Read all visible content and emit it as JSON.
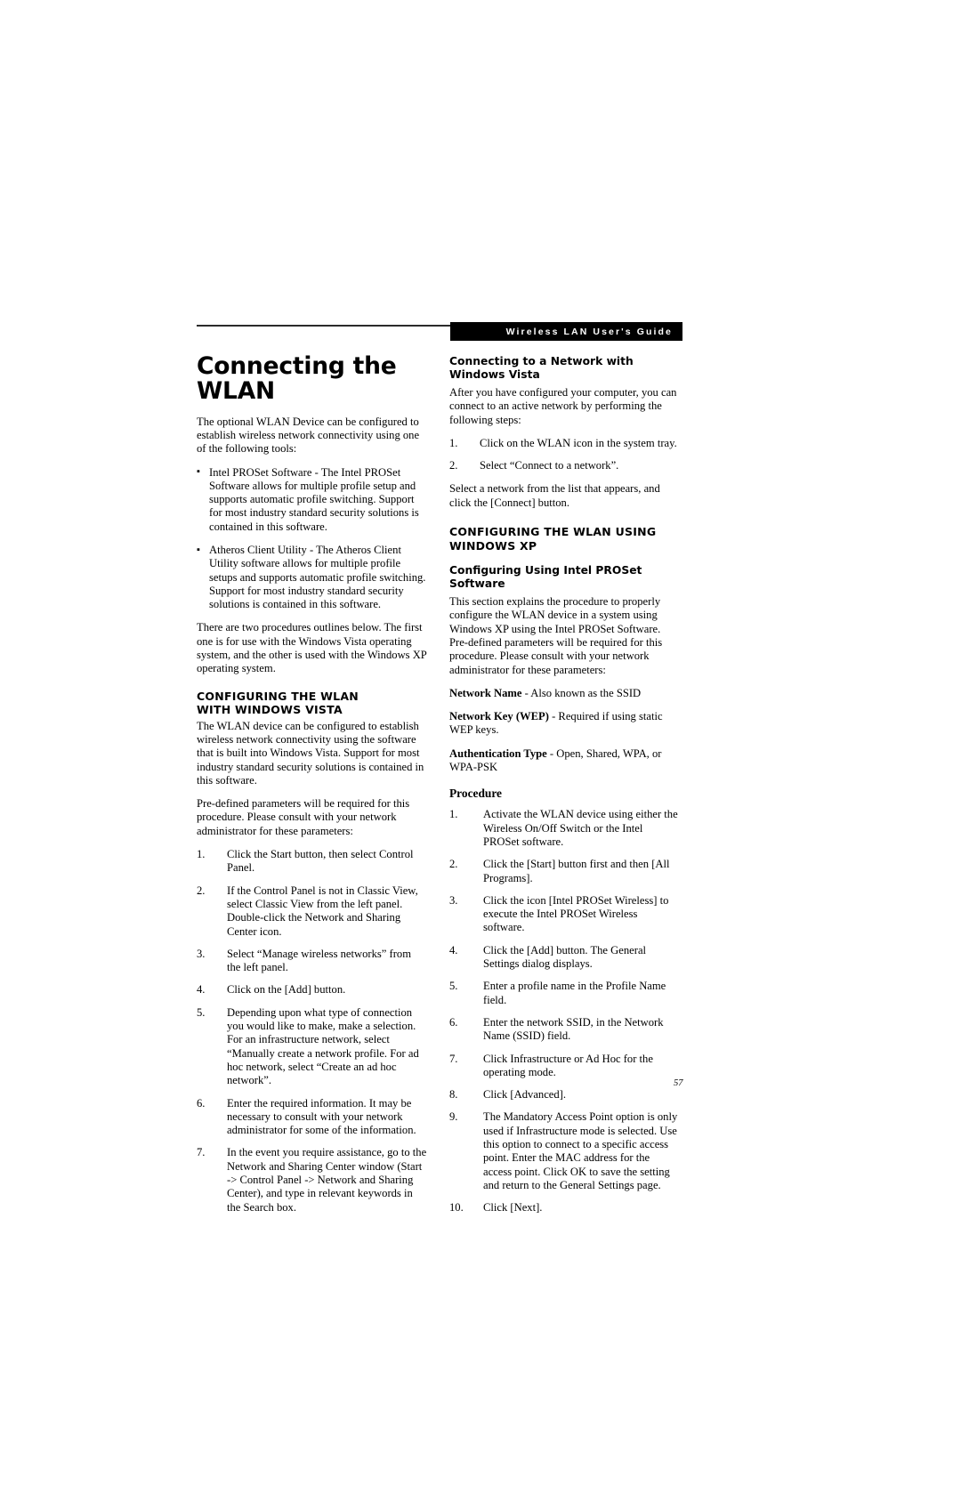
{
  "header": {
    "running_head": "Wireless LAN User's Guide"
  },
  "page_number": "57",
  "left_column": {
    "title": "Connecting the WLAN",
    "intro": "The optional WLAN Device can be configured to establish wireless network connectivity using one of the following tools:",
    "tools": [
      "Intel PROSet Software - The Intel PROSet Software allows for multiple profile setup and supports automatic profile switching. Support for most industry standard security solutions is contained in this software.",
      "Atheros Client Utility - The Atheros Client Utility software allows for multiple profile setups and supports automatic profile switching. Support for most industry standard security solutions is contained in this software."
    ],
    "procedures_note": "There are two procedures outlines below. The first one is for use with the Windows Vista operating system, and the other is used with the Windows XP operating system.",
    "vista_heading_line1": "CONFIGURING THE WLAN",
    "vista_heading_line2": "WITH WINDOWS VISTA",
    "vista_intro": "The WLAN device can be configured to establish wireless network connectivity using the software that is built into Windows Vista. Support for most industry standard security solutions is contained in this software.",
    "vista_predefined": "Pre-defined parameters will be required for this procedure. Please consult with your network administrator for these parameters:",
    "vista_steps": [
      {
        "num": "1.",
        "text": "Click the Start button, then select Control Panel."
      },
      {
        "num": "2.",
        "text": "If the Control Panel is not in Classic View, select Classic View from the left panel. Double-click the Network and Sharing Center icon."
      },
      {
        "num": "3.",
        "text": "Select “Manage wireless networks” from the left panel."
      },
      {
        "num": "4.",
        "text": "Click on the [Add] button."
      },
      {
        "num": "5.",
        "text": "Depending upon what type of connection you would like to make, make a selection. For an infrastructure network, select “Manually create a network profile. For ad hoc network, select “Create an ad hoc network”."
      },
      {
        "num": "6.",
        "text": "Enter the required information. It may be necessary to consult with your network administrator for some of the information."
      },
      {
        "num": "7.",
        "text": "In the event you require assistance, go to the Network and Sharing Center window (Start -> Control Panel -> Network and Sharing Center), and type in relevant keywords in the Search box."
      }
    ]
  },
  "right_column": {
    "connect_heading": "Connecting to a Network with Windows Vista",
    "connect_intro": "After you have configured your computer, you can connect to an active network by performing the following steps:",
    "connect_steps": [
      {
        "num": "1.",
        "text": "Click on the WLAN icon in the system tray."
      },
      {
        "num": "2.",
        "text": "Select “Connect to a network”."
      }
    ],
    "connect_outro": "Select a network from the list that appears, and click the [Connect] button.",
    "xp_heading_line1": "CONFIGURING THE WLAN USING",
    "xp_heading_line2": "WINDOWS XP",
    "xp_subheading": "Configuring Using Intel PROSet Software",
    "xp_intro": "This section explains the procedure to properly configure the WLAN device in a system using Windows XP using the Intel PROSet Software. Pre-defined parameters will be required for this procedure. Please consult with your network administrator for these parameters:",
    "definitions": [
      {
        "term": "Network Name",
        "rest": " - Also known as the SSID"
      },
      {
        "term": "Network Key (WEP)",
        "rest": " - Required if using static WEP keys."
      },
      {
        "term": "Authentication Type",
        "rest": " - Open, Shared, WPA, or WPA-PSK"
      }
    ],
    "procedure_heading": "Procedure",
    "procedure_steps": [
      {
        "num": "1.",
        "text": "Activate the WLAN device using either the Wireless On/Off Switch or the Intel PROSet software."
      },
      {
        "num": "2.",
        "text": "Click the [Start] button first and then [All Programs]."
      },
      {
        "num": "3.",
        "text": "Click the icon [Intel PROSet Wireless] to execute the Intel PROSet Wireless software."
      },
      {
        "num": "4.",
        "text": "Click the [Add] button. The General Settings dialog displays."
      },
      {
        "num": "5.",
        "text": "Enter a profile name in the Profile Name field."
      },
      {
        "num": "6.",
        "text": "Enter the network SSID, in the Network Name (SSID) field."
      },
      {
        "num": "7.",
        "text": "Click Infrastructure or Ad Hoc for the operating mode."
      },
      {
        "num": "8.",
        "text": "Click [Advanced]."
      },
      {
        "num": "9.",
        "text": "The Mandatory Access Point option is only used if Infrastructure mode is selected. Use this option to connect to a specific access point. Enter the MAC address for the access point. Click OK to save the setting and return to the General Settings page."
      },
      {
        "num": "10.",
        "text": "Click [Next]."
      }
    ]
  }
}
